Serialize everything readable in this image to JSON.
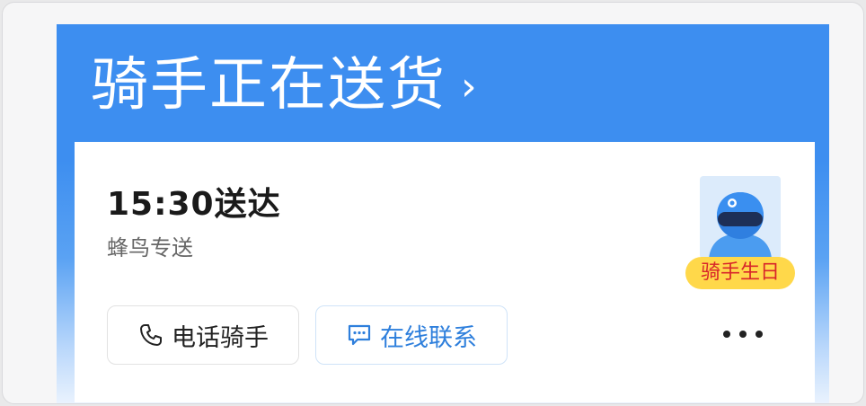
{
  "header": {
    "title": "骑手正在送货",
    "chevron": "›"
  },
  "delivery": {
    "eta": "15:30送达",
    "carrier": "蜂鸟专送"
  },
  "rider": {
    "badge": "骑手生日"
  },
  "actions": {
    "call_label": "电话骑手",
    "call_icon": "phone-icon",
    "chat_label": "在线联系",
    "chat_icon": "chat-bubble-icon",
    "more_icon": "more-icon"
  },
  "colors": {
    "header_blue": "#3d8ef0",
    "accent_blue": "#2e7fdc",
    "badge_yellow": "#ffd84a",
    "badge_text": "#d8262a"
  }
}
